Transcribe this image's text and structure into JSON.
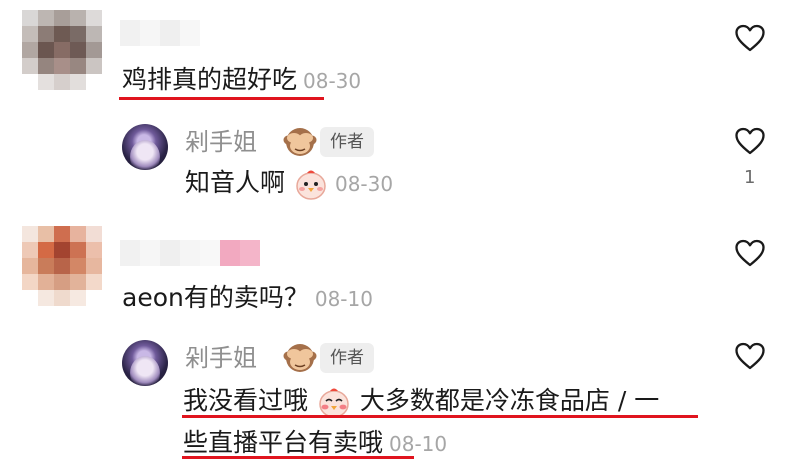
{
  "comments": [
    {
      "text": "鸡排真的超好吃",
      "date": "08-30",
      "likes": ""
    },
    {
      "author": "剁手姐",
      "badge": "作者",
      "text": "知音人啊",
      "date": "08-30",
      "likes": "1"
    },
    {
      "text": "aeon有的卖吗？",
      "date": "08-10",
      "likes": ""
    },
    {
      "author": "剁手姐",
      "badge": "作者",
      "text_line1": "我没看过哦",
      "text_line1b": "大多数都是冷冻食品店 / 一",
      "text_line2": "些直播平台有卖哦",
      "date": "08-10",
      "likes": ""
    }
  ],
  "icons": {
    "like": "heart-outline-icon",
    "author_emoji": "see-no-evil-monkey-icon",
    "reaction_emoji_1": "chick-face-icon",
    "reaction_emoji_2": "blushing-chick-face-icon"
  },
  "colors": {
    "highlight_underline": "#e0141e",
    "date": "#a6a6a6",
    "author_name": "#8f8f8f"
  }
}
